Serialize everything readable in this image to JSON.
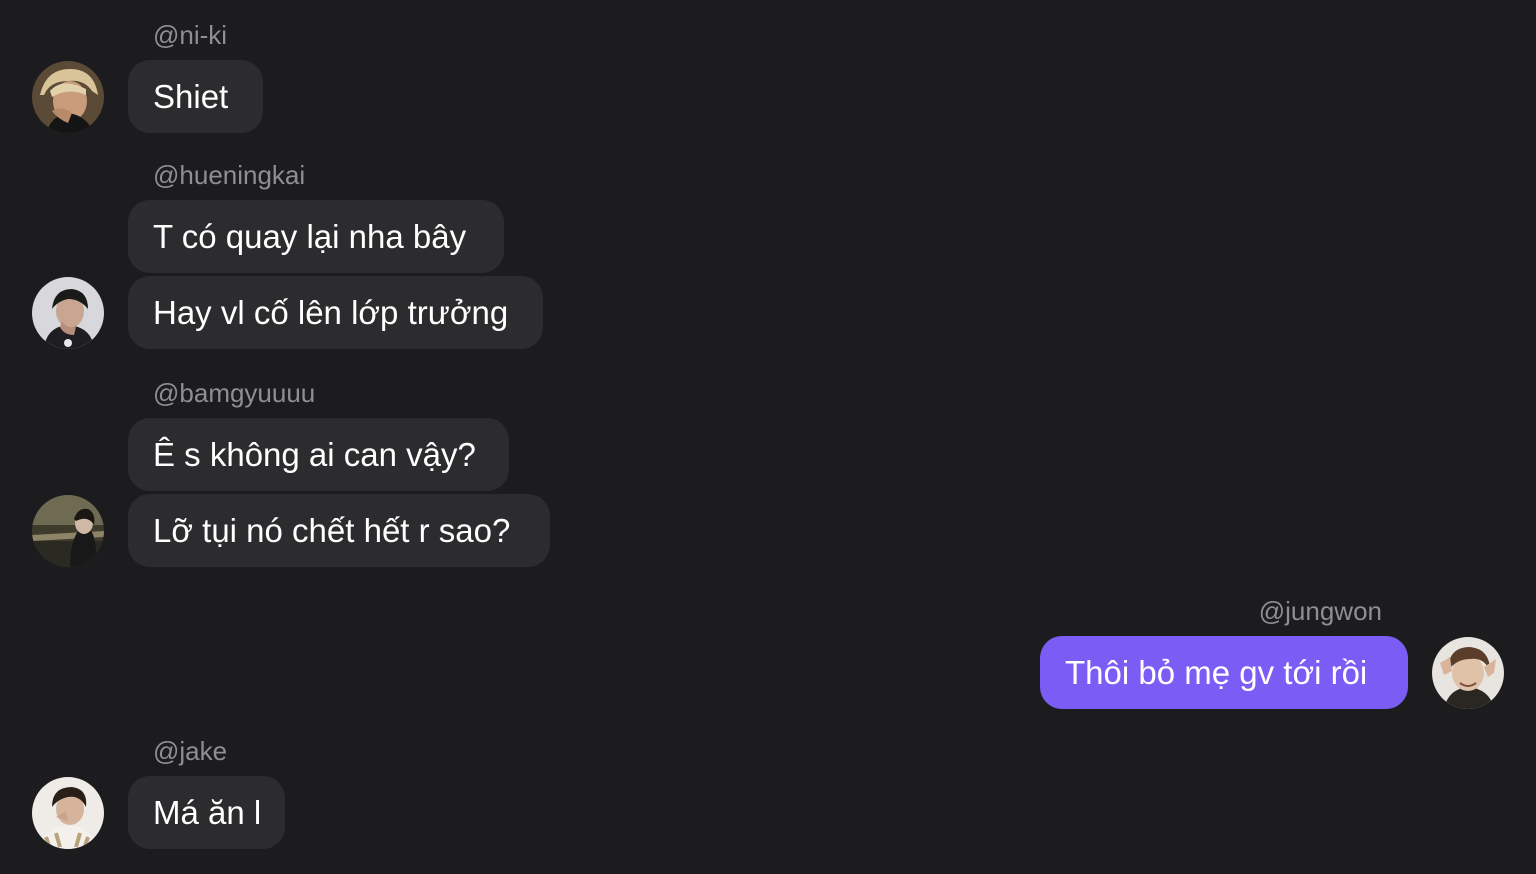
{
  "colors": {
    "background": "#1c1c1e",
    "bubble_incoming": "#2c2c2e",
    "bubble_outgoing": "#7b5cf5",
    "username": "#8e8e93",
    "message_text": "#ffffff"
  },
  "messages": [
    {
      "username": "@ni-ki",
      "side": "incoming",
      "avatar_icon": "user-avatar",
      "bubbles": [
        "Shiet"
      ]
    },
    {
      "username": "@hueningkai",
      "side": "incoming",
      "avatar_icon": "user-avatar",
      "bubbles": [
        "T có quay lại nha bây",
        "Hay vl cố lên lớp trưởng"
      ]
    },
    {
      "username": "@bamgyuuuu",
      "side": "incoming",
      "avatar_icon": "user-avatar",
      "bubbles": [
        "Ê s không ai can vậy?",
        "Lỡ tụi nó chết hết r sao?"
      ]
    },
    {
      "username": "@jungwon",
      "side": "outgoing",
      "avatar_icon": "user-avatar",
      "bubbles": [
        "Thôi bỏ mẹ gv tới rồi"
      ]
    },
    {
      "username": "@jake",
      "side": "incoming",
      "avatar_icon": "user-avatar",
      "bubbles": [
        "Má ăn l"
      ]
    }
  ]
}
